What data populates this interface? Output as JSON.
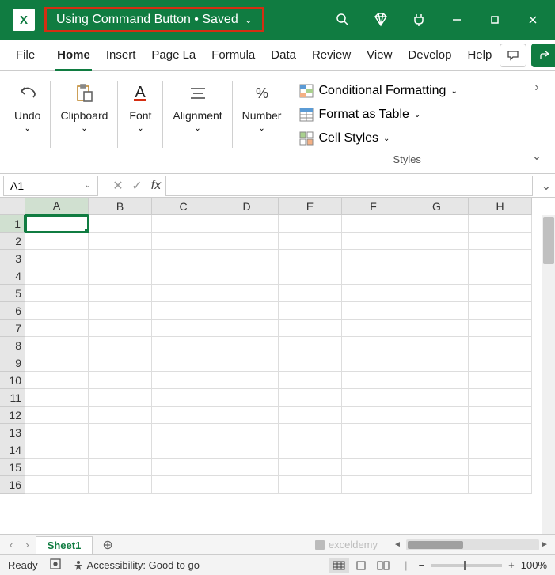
{
  "titlebar": {
    "app_abbrev": "X",
    "title": "Using Command Button • Saved"
  },
  "tabs": {
    "file": "File",
    "home": "Home",
    "insert": "Insert",
    "pagelayout": "Page La",
    "formulas": "Formula",
    "data": "Data",
    "review": "Review",
    "view": "View",
    "developer": "Develop",
    "help": "Help"
  },
  "ribbon": {
    "undo": "Undo",
    "clipboard": "Clipboard",
    "font": "Font",
    "alignment": "Alignment",
    "number": "Number",
    "cond_format": "Conditional Formatting",
    "format_table": "Format as Table",
    "cell_styles": "Cell Styles",
    "styles_group": "Styles"
  },
  "namebox": {
    "value": "A1"
  },
  "columns": [
    "A",
    "B",
    "C",
    "D",
    "E",
    "F",
    "G",
    "H"
  ],
  "rows": [
    "1",
    "2",
    "3",
    "4",
    "5",
    "6",
    "7",
    "8",
    "9",
    "10",
    "11",
    "12",
    "13",
    "14",
    "15",
    "16"
  ],
  "sheet": {
    "active": "Sheet1"
  },
  "watermark": "exceldemy",
  "status": {
    "ready": "Ready",
    "accessibility": "Accessibility: Good to go",
    "zoom": "100%"
  }
}
